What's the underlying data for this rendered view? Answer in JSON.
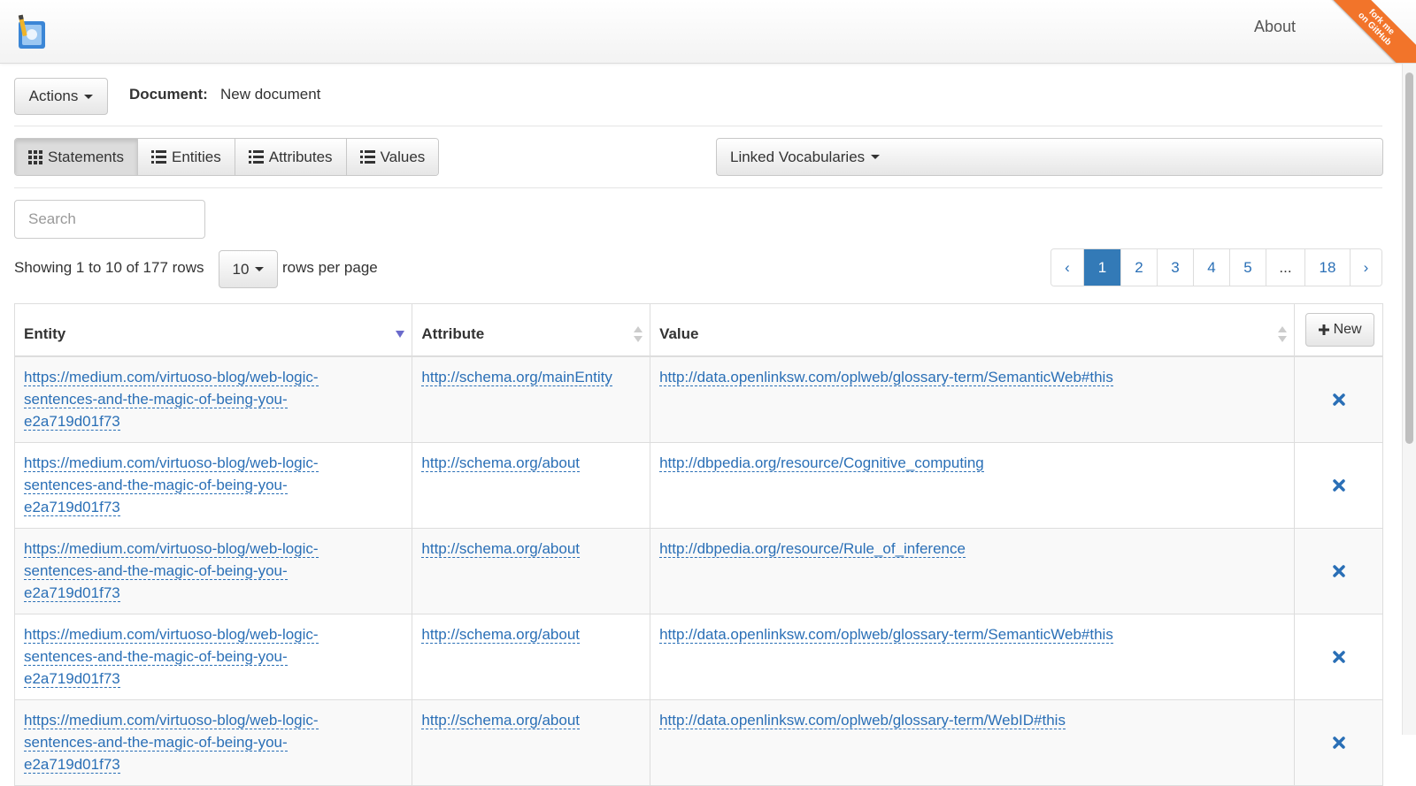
{
  "nav": {
    "about": "About",
    "ribbon_line1": "fork me",
    "ribbon_line2": "on GitHub"
  },
  "toolbar": {
    "actions_label": "Actions",
    "document_label": "Document:",
    "document_value": "New document"
  },
  "tabs": [
    {
      "label": "Statements",
      "icon": "grid-icon"
    },
    {
      "label": "Entities",
      "icon": "list-icon"
    },
    {
      "label": "Attributes",
      "icon": "list-icon"
    },
    {
      "label": "Values",
      "icon": "list-icon"
    }
  ],
  "vocab": {
    "label": "Linked Vocabularies"
  },
  "search": {
    "placeholder": "Search",
    "value": ""
  },
  "paging": {
    "showing": "Showing 1 to 10 of 177 rows",
    "rows_per_page_value": "10",
    "rows_per_page_label": "rows per page",
    "pages": [
      "‹",
      "1",
      "2",
      "3",
      "4",
      "5",
      "...",
      "18",
      "›"
    ],
    "active_page": "1"
  },
  "table": {
    "headers": {
      "entity": "Entity",
      "attribute": "Attribute",
      "value": "Value",
      "new_button": "New"
    },
    "rows": [
      {
        "entity": [
          "https://medium.com/virtuoso-blog/web-logic-",
          "sentences-and-the-magic-of-being-you-",
          "e2a719d01f73"
        ],
        "attribute": "http://schema.org/mainEntity",
        "value": "http://data.openlinksw.com/oplweb/glossary-term/SemanticWeb#this"
      },
      {
        "entity": [
          "https://medium.com/virtuoso-blog/web-logic-",
          "sentences-and-the-magic-of-being-you-",
          "e2a719d01f73"
        ],
        "attribute": "http://schema.org/about",
        "value": "http://dbpedia.org/resource/Cognitive_computing"
      },
      {
        "entity": [
          "https://medium.com/virtuoso-blog/web-logic-",
          "sentences-and-the-magic-of-being-you-",
          "e2a719d01f73"
        ],
        "attribute": "http://schema.org/about",
        "value": "http://dbpedia.org/resource/Rule_of_inference"
      },
      {
        "entity": [
          "https://medium.com/virtuoso-blog/web-logic-",
          "sentences-and-the-magic-of-being-you-",
          "e2a719d01f73"
        ],
        "attribute": "http://schema.org/about",
        "value": "http://data.openlinksw.com/oplweb/glossary-term/SemanticWeb#this"
      },
      {
        "entity": [
          "https://medium.com/virtuoso-blog/web-logic-",
          "sentences-and-the-magic-of-being-you-",
          "e2a719d01f73"
        ],
        "attribute": "http://schema.org/about",
        "value": "http://data.openlinksw.com/oplweb/glossary-term/WebID#this"
      }
    ]
  },
  "colors": {
    "link": "#2a6fb6",
    "active_page": "#337ab7",
    "ribbon": "#f2742a",
    "delete_icon": "#2a6fb6"
  }
}
